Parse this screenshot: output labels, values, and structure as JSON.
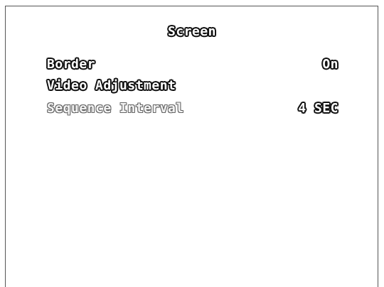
{
  "menu": {
    "title": "Screen",
    "items": [
      {
        "label": "Border",
        "value": "On"
      },
      {
        "label": "Video Adjustment",
        "value": ""
      },
      {
        "label": "Sequence Interval",
        "value": "4 SEC"
      }
    ]
  }
}
